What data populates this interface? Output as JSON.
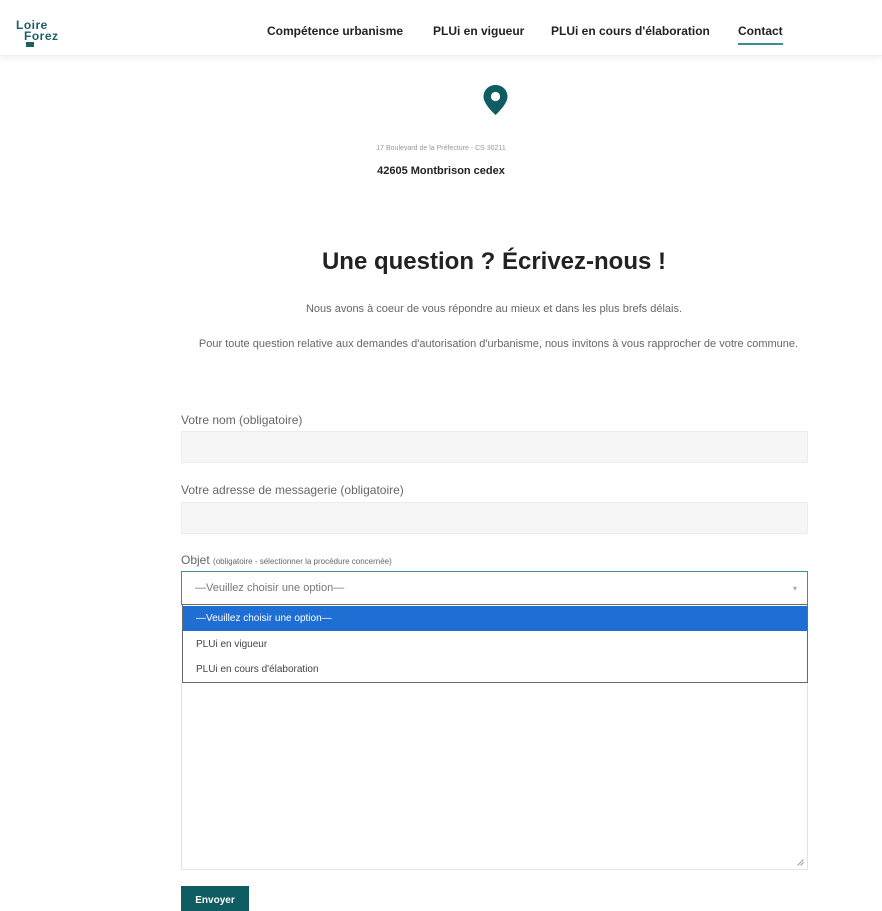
{
  "header": {
    "logo": {
      "line1": "Loire",
      "line2": "Forez"
    },
    "nav": [
      "Compétence urbanisme",
      "PLUi en vigueur",
      "PLUi en cours d'élaboration",
      "Contact"
    ]
  },
  "address": {
    "line1": "17 Boulevard de la Préfecture - CS 30211",
    "line2": "42605 Montbrison cedex"
  },
  "main": {
    "title": "Une question ? Écrivez-nous !",
    "intro1": "Nous avons à coeur de vous répondre au mieux et dans les plus brefs délais.",
    "intro2": "Pour toute question relative aux demandes d'autorisation d'urbanisme, nous invitons à vous rapprocher de votre commune."
  },
  "form": {
    "name_label": "Votre nom (obligatoire)",
    "name_value": "",
    "email_label": "Votre adresse de messagerie (obligatoire)",
    "email_value": "",
    "subject_label": "Objet",
    "subject_hint": "(obligatoire - sélectionner la procédure concernée)",
    "subject_value": "—Veuillez choisir une option—",
    "options": [
      "—Veuillez choisir une option—",
      "PLUi en vigueur",
      "PLUi en cours d'élaboration"
    ],
    "submit_label": "Envoyer"
  },
  "colors": {
    "brand": "#0f5d63",
    "accent": "#3a8f95",
    "highlight": "#1f6ed3"
  },
  "icons": [
    "map-pin-icon",
    "chevron-down-icon",
    "resize-grip-icon"
  ]
}
